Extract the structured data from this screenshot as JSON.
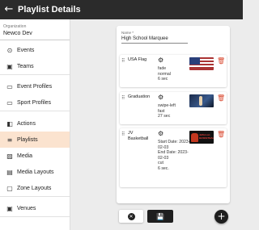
{
  "header": {
    "back_icon": "arrow-left-icon",
    "title": "Playlist Details"
  },
  "organization": {
    "label": "Organization",
    "value": "Newco Dev"
  },
  "sidebar": {
    "groups": [
      [
        {
          "label": "Events",
          "icon": "play-circle-icon"
        },
        {
          "label": "Teams",
          "icon": "contacts-icon"
        }
      ],
      [
        {
          "label": "Event Profiles",
          "icon": "profile-card-icon"
        },
        {
          "label": "Sport Profiles",
          "icon": "profile-card-icon"
        }
      ],
      [
        {
          "label": "Actions",
          "icon": "layers-icon"
        },
        {
          "label": "Playlists",
          "icon": "playlist-icon",
          "active": true
        },
        {
          "label": "Media",
          "icon": "image-icon"
        },
        {
          "label": "Media Layouts",
          "icon": "layout-icon"
        },
        {
          "label": "Zone Layouts",
          "icon": "zone-icon"
        }
      ],
      [
        {
          "label": "Venues",
          "icon": "contacts-icon"
        }
      ]
    ]
  },
  "form": {
    "name_label": "Name *",
    "name_value": "High School Marquee"
  },
  "playlist_items": [
    {
      "name": "USA Flag",
      "meta": [
        "fade",
        "normal",
        "6 sec"
      ],
      "thumb": "flag"
    },
    {
      "name": "Graduation",
      "meta": [
        "swipe-left",
        "fast",
        "27 sec"
      ],
      "thumb": "grad"
    },
    {
      "name": "JV Basketball",
      "meta": [
        "Start Date: 2023-02-03",
        "End Date: 2023-02-03",
        "cut",
        "6 sec."
      ],
      "thumb": "jv",
      "thumb_text": "Jefferson\nBASKETBALL"
    }
  ],
  "colors": {
    "active_nav": "#fbe3cf",
    "delete": "#d9482f",
    "topbar": "#2b2b2b"
  }
}
